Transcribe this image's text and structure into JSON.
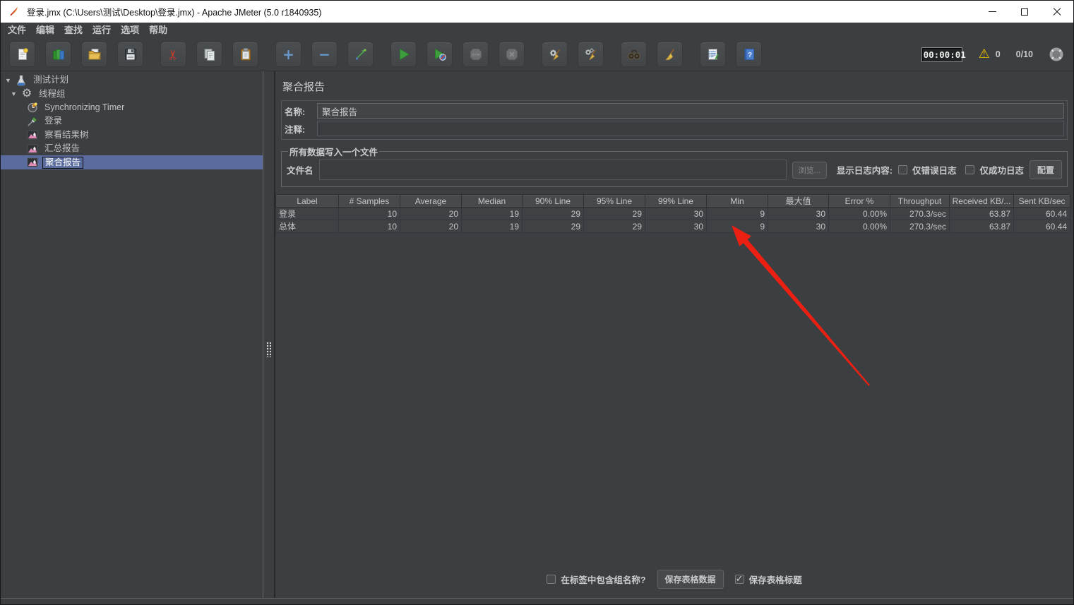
{
  "window": {
    "title": "登录.jmx (C:\\Users\\测试\\Desktop\\登录.jmx) - Apache JMeter (5.0 r1840935)",
    "controls": [
      "minimize",
      "maximize",
      "close"
    ]
  },
  "menu": {
    "items": [
      "文件",
      "编辑",
      "查找",
      "运行",
      "选项",
      "帮助"
    ]
  },
  "toolbar": {
    "buttons": [
      "new",
      "templates",
      "open",
      "save",
      "cut",
      "copy",
      "paste",
      "add",
      "remove",
      "toggle",
      "start",
      "start-no-pauses",
      "stop",
      "shutdown",
      "clear",
      "clear-all",
      "search",
      "clear-search",
      "function-helper",
      "help"
    ],
    "timer": "00:00:01",
    "error_count": "0",
    "thread_count": "0/10"
  },
  "icons": {
    "collapse_glyph": "▼",
    "scissors_glyph": "✂",
    "warning_glyph": "⚠",
    "check_glyph": "✓",
    "plus_glyph": "+",
    "minus_glyph": "−",
    "gear_glyph": "⚙"
  },
  "tree": {
    "items": [
      {
        "label": "测试计划",
        "level": 0,
        "icon": "test-plan",
        "expanded": true,
        "selected": false
      },
      {
        "label": "线程组",
        "level": 1,
        "icon": "thread-group",
        "expanded": true,
        "selected": false
      },
      {
        "label": "Synchronizing Timer",
        "level": 2,
        "icon": "timer",
        "selected": false
      },
      {
        "label": "登录",
        "level": 2,
        "icon": "sampler",
        "selected": false
      },
      {
        "label": "察看结果树",
        "level": 2,
        "icon": "listener",
        "selected": false
      },
      {
        "label": "汇总报告",
        "level": 2,
        "icon": "listener",
        "selected": false
      },
      {
        "label": "聚合报告",
        "level": 2,
        "icon": "listener",
        "selected": true
      }
    ]
  },
  "main": {
    "title": "聚合报告",
    "name_label": "名称:",
    "name_value": "聚合报告",
    "comment_label": "注释:",
    "comment_value": "",
    "file_group": {
      "legend": "所有数据写入一个文件",
      "filename_label": "文件名",
      "filename_value": "",
      "browse_label": "浏览...",
      "log_display_label": "显示日志内容:",
      "errors_only_label": "仅错误日志",
      "errors_only_checked": false,
      "success_only_label": "仅成功日志",
      "success_only_checked": false,
      "configure_label": "配置"
    },
    "table": {
      "columns": [
        "Label",
        "# Samples",
        "Average",
        "Median",
        "90% Line",
        "95% Line",
        "99% Line",
        "Min",
        "最大值",
        "Error %",
        "Throughput",
        "Received KB/...",
        "Sent KB/sec"
      ],
      "rows": [
        [
          "登录",
          "10",
          "20",
          "19",
          "29",
          "29",
          "30",
          "9",
          "30",
          "0.00%",
          "270.3/sec",
          "63.87",
          "60.44"
        ],
        [
          "总体",
          "10",
          "20",
          "19",
          "29",
          "29",
          "30",
          "9",
          "30",
          "0.00%",
          "270.3/sec",
          "63.87",
          "60.44"
        ]
      ]
    },
    "footer": {
      "include_group_label": "在标签中包含组名称?",
      "include_group_checked": false,
      "save_table_label": "保存表格数据",
      "save_header_label": "保存表格标题",
      "save_header_checked": true
    }
  },
  "colors": {
    "selection_blue": "#5a6b9e",
    "arrow_red": "#ec1f13",
    "warning_yellow": "#f2c400",
    "toolbar_accent_blue": "#6897cb",
    "start_green": "#3e9e3e"
  }
}
